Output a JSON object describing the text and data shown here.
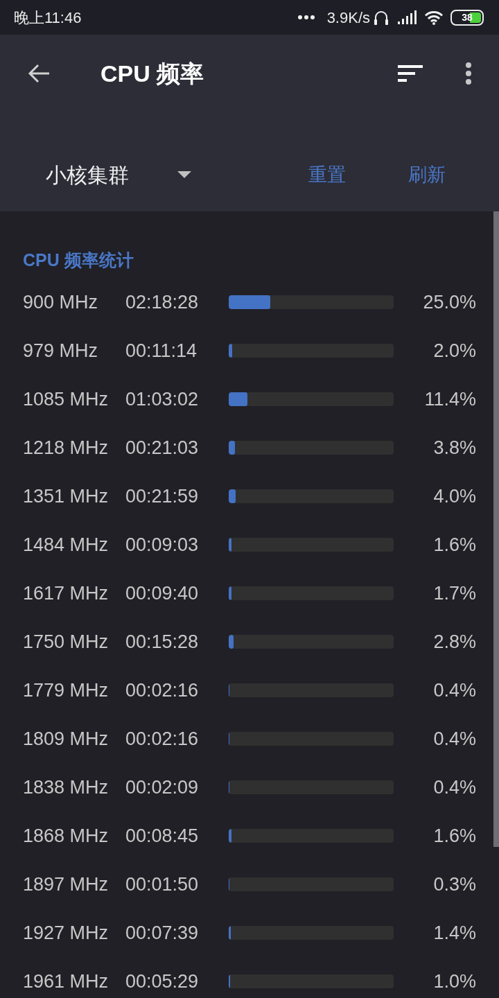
{
  "status_bar": {
    "time": "晚上11:46",
    "network_speed": "3.9K/s",
    "battery": "38"
  },
  "toolbar": {
    "title": "CPU 频率"
  },
  "cluster_selector": {
    "value": "小核集群"
  },
  "actions": [
    "重置",
    "刷新"
  ],
  "section": {
    "title": "CPU 频率统计"
  },
  "rows": [
    {
      "frequency": "900 MHz",
      "time": "02:18:28",
      "level": 0.25,
      "percent": "25.0%"
    },
    {
      "frequency": "979 MHz",
      "time": "00:11:14",
      "level": 0.02,
      "percent": "2.0%"
    },
    {
      "frequency": "1085 MHz",
      "time": "01:03:02",
      "level": 0.114,
      "percent": "11.4%"
    },
    {
      "frequency": "1218 MHz",
      "time": "00:21:03",
      "level": 0.038,
      "percent": "3.8%"
    },
    {
      "frequency": "1351 MHz",
      "time": "00:21:59",
      "level": 0.04,
      "percent": "4.0%"
    },
    {
      "frequency": "1484 MHz",
      "time": "00:09:03",
      "level": 0.016,
      "percent": "1.6%"
    },
    {
      "frequency": "1617 MHz",
      "time": "00:09:40",
      "level": 0.017,
      "percent": "1.7%"
    },
    {
      "frequency": "1750 MHz",
      "time": "00:15:28",
      "level": 0.028,
      "percent": "2.8%"
    },
    {
      "frequency": "1779 MHz",
      "time": "00:02:16",
      "level": 0.004,
      "percent": "0.4%"
    },
    {
      "frequency": "1809 MHz",
      "time": "00:02:16",
      "level": 0.004,
      "percent": "0.4%"
    },
    {
      "frequency": "1838 MHz",
      "time": "00:02:09",
      "level": 0.004,
      "percent": "0.4%"
    },
    {
      "frequency": "1868 MHz",
      "time": "00:08:45",
      "level": 0.016,
      "percent": "1.6%"
    },
    {
      "frequency": "1897 MHz",
      "time": "00:01:50",
      "level": 0.003,
      "percent": "0.3%"
    },
    {
      "frequency": "1927 MHz",
      "time": "00:07:39",
      "level": 0.014,
      "percent": "1.4%"
    },
    {
      "frequency": "1961 MHz",
      "time": "00:05:29",
      "level": 0.01,
      "percent": "1.0%"
    }
  ]
}
